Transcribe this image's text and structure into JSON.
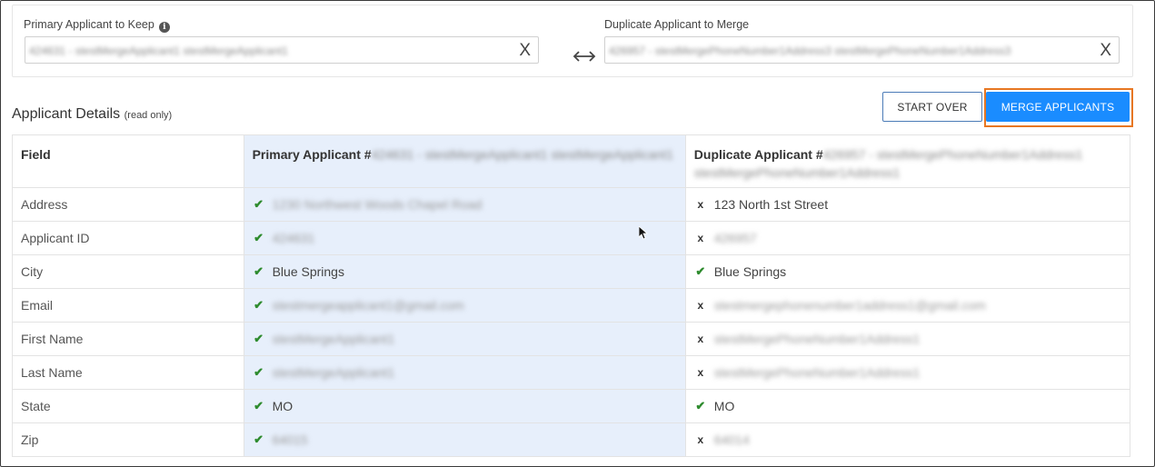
{
  "selector": {
    "primary_label": "Primary Applicant to Keep",
    "primary_value": "424631 - stestMergeApplicant1 stestMergeApplicant1",
    "duplicate_label": "Duplicate Applicant to Merge",
    "duplicate_value": "426957 - stestMergePhoneNumber1Address3 stestMergePhoneNumber1Address3",
    "clear_glyph": "X"
  },
  "details": {
    "title": "Applicant Details",
    "subtitle": "(read only)"
  },
  "actions": {
    "start_over": "START OVER",
    "merge": "MERGE APPLICANTS"
  },
  "table": {
    "columns": {
      "field": "Field",
      "primary_prefix": "Primary Applicant #",
      "primary_id": "424631",
      "primary_name": "- stestMergeApplicant1 stestMergeApplicant1",
      "duplicate_prefix": "Duplicate Applicant #",
      "duplicate_id": "426957",
      "duplicate_name": "- stestMergePhoneNumber1Address1 stestMergePhoneNumber1Address1"
    },
    "rows": [
      {
        "field": "Address",
        "primary": "1230 Northwest Woods Chapel Road",
        "primary_mark": "✔",
        "duplicate": "123 North 1st Street",
        "duplicate_mark": "x"
      },
      {
        "field": "Applicant ID",
        "primary": "424631",
        "primary_mark": "✔",
        "duplicate": "426957",
        "duplicate_mark": "x"
      },
      {
        "field": "City",
        "primary": "Blue Springs",
        "primary_mark": "✔",
        "duplicate": "Blue Springs",
        "duplicate_mark": "✔"
      },
      {
        "field": "Email",
        "primary": "stestmergeapplicant1@gmail.com",
        "primary_mark": "✔",
        "duplicate": "stestmergephonenumber1address1@gmail.com",
        "duplicate_mark": "x"
      },
      {
        "field": "First Name",
        "primary": "stestMergeApplicant1",
        "primary_mark": "✔",
        "duplicate": "stestMergePhoneNumber1Address1",
        "duplicate_mark": "x"
      },
      {
        "field": "Last Name",
        "primary": "stestMergeApplicant1",
        "primary_mark": "✔",
        "duplicate": "stestMergePhoneNumber1Address1",
        "duplicate_mark": "x"
      },
      {
        "field": "State",
        "primary": "MO",
        "primary_mark": "✔",
        "duplicate": "MO",
        "duplicate_mark": "✔"
      },
      {
        "field": "Zip",
        "primary": "64015",
        "primary_mark": "✔",
        "duplicate": "64014",
        "duplicate_mark": "x"
      }
    ]
  },
  "colors": {
    "primary_button": "#1a8cff",
    "focus_ring": "#e87722",
    "primary_column_bg": "#e7effb",
    "check": "#2e8b2e"
  }
}
